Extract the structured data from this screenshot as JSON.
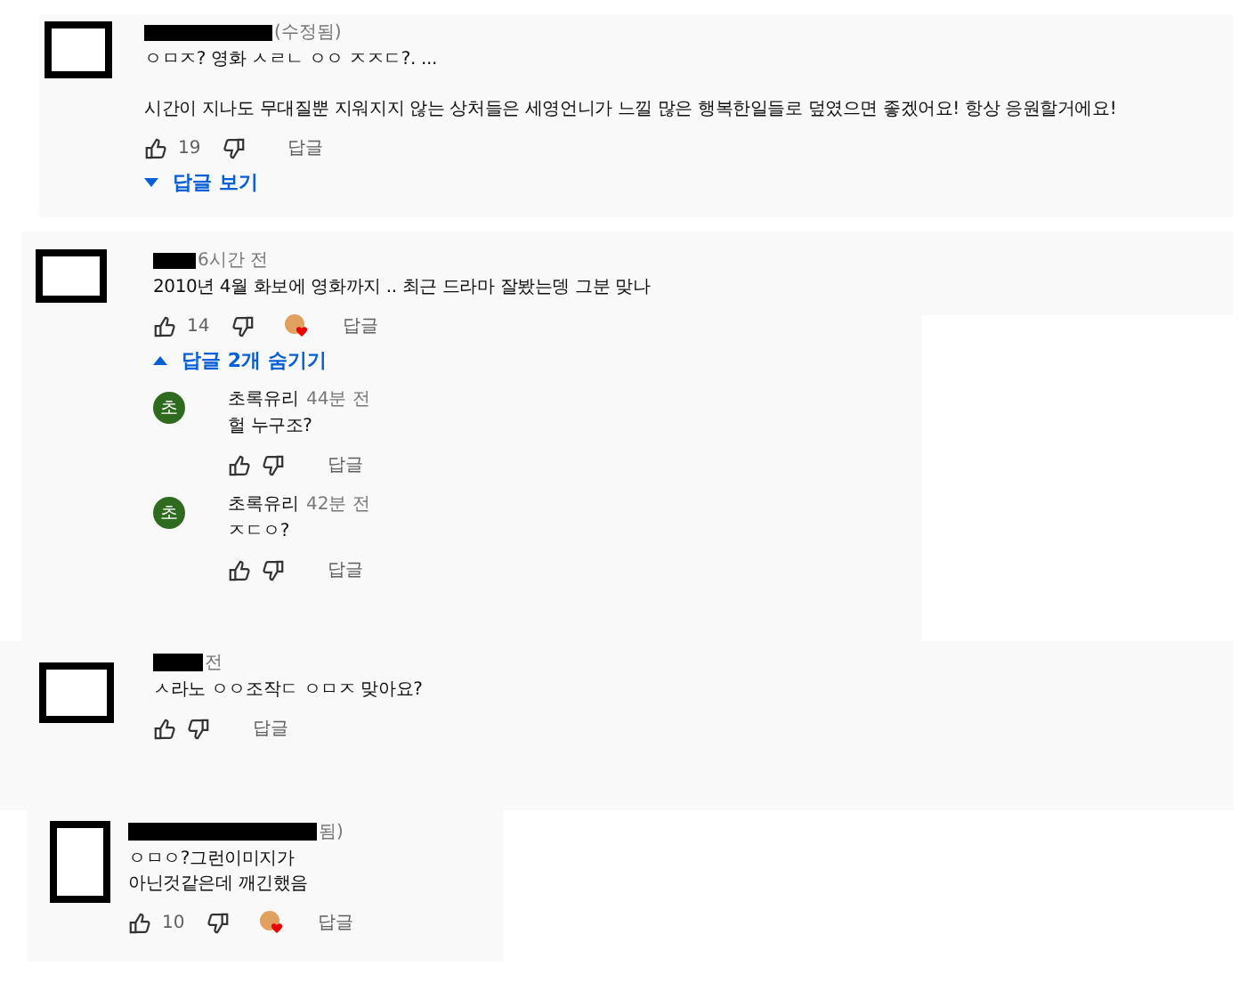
{
  "comments": [
    {
      "meta": "(수정됨)",
      "paragraphs": [
        "ㅇㅁㅈ? 영화 ㅅㄹㄴ ㅇㅇ ㅈㅈㄷ?. ...",
        "시간이 지나도 무대질뿐 지워지지 않는 상처들은 세영언니가 느낄 많은 행복한일들로 덮였으면 좋겠어요! 항상 응원할거에요!"
      ],
      "likes": "19",
      "creator_heart": false,
      "reply_button": "답글",
      "replies_toggle": {
        "label": "답글 보기",
        "expanded": false
      }
    },
    {
      "meta": "6시간 전",
      "paragraphs": [
        "2010년 4월 화보에 영화까지 .. 최근 드라마 잘봤는뎅 그분 맞나"
      ],
      "likes": "14",
      "creator_heart": true,
      "reply_button": "답글",
      "replies_toggle": {
        "label": "답글 2개 숨기기",
        "expanded": true
      },
      "replies": [
        {
          "avatar_letter": "초",
          "author": "초록유리",
          "meta": "44분 전",
          "text": "헐 누구조?",
          "reply_button": "답글"
        },
        {
          "avatar_letter": "초",
          "author": "초록유리",
          "meta": "42분 전",
          "text": "ㅈㄷㅇ?",
          "reply_button": "답글"
        }
      ]
    },
    {
      "meta": "전",
      "paragraphs": [
        "ㅅ라노 ㅇㅇ조작ㄷ  ㅇㅁㅈ 맞아요?"
      ],
      "creator_heart": false,
      "reply_button": "답글"
    },
    {
      "meta": "됨)",
      "paragraphs": [
        "ㅇㅁㅇ?그런이미지가\n아닌것같은데 깨긴했음"
      ],
      "likes": "10",
      "creator_heart": true,
      "reply_button": "답글"
    }
  ]
}
